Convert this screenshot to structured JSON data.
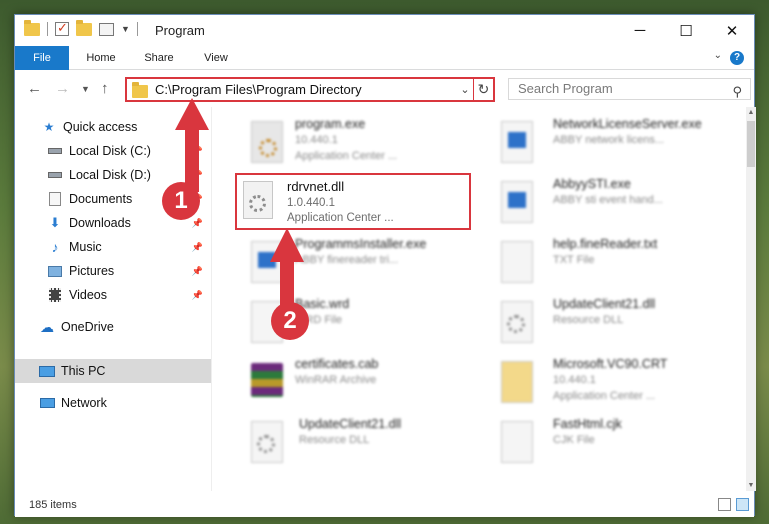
{
  "window": {
    "title": "Program",
    "controls": {
      "minimize": "─",
      "maximize": "☐",
      "close": "✕"
    }
  },
  "ribbon": {
    "tabs": [
      "File",
      "Home",
      "Share",
      "View"
    ],
    "help": "?"
  },
  "address_bar": {
    "path": "C:\\Program Files\\Program Directory",
    "search_placeholder": "Search Program"
  },
  "nav_pane": {
    "items": [
      {
        "label": "Quick access",
        "icon": "star-icon",
        "pinned": false
      },
      {
        "label": "Local Disk (C:)",
        "icon": "drive-icon",
        "pinned": true
      },
      {
        "label": "Local Disk (D:)",
        "icon": "drive-icon",
        "pinned": true
      },
      {
        "label": "Documents",
        "icon": "documents-icon",
        "pinned": true
      },
      {
        "label": "Downloads",
        "icon": "download-icon",
        "pinned": true
      },
      {
        "label": "Music",
        "icon": "music-icon",
        "pinned": true
      },
      {
        "label": "Pictures",
        "icon": "pictures-icon",
        "pinned": true
      },
      {
        "label": "Videos",
        "icon": "videos-icon",
        "pinned": true
      },
      {
        "label": "OneDrive",
        "icon": "cloud-icon",
        "pinned": false
      },
      {
        "label": "This PC",
        "icon": "computer-icon",
        "pinned": false,
        "selected": true
      },
      {
        "label": "Network",
        "icon": "network-icon",
        "pinned": false
      }
    ]
  },
  "files": [
    {
      "name": "program.exe",
      "line2": "10.440.1",
      "line3": "Application Center ...",
      "icon": "exe-icon"
    },
    {
      "name": "NetworkLicenseServer.exe",
      "line2": "ABBY network licens...",
      "line3": "",
      "icon": "window-app-icon"
    },
    {
      "name": "rdrvnet.dll",
      "line2": "1.0.440.1",
      "line3": "Application Center ...",
      "icon": "dll-gear-icon",
      "highlighted": true
    },
    {
      "name": "AbbyySTI.exe",
      "line2": "ABBY sti event hand...",
      "line3": "",
      "icon": "window-app-icon"
    },
    {
      "name": "ProgrammsInstaller.exe",
      "line2": "ABBY finereader tri...",
      "line3": "",
      "icon": "window-app-icon"
    },
    {
      "name": "help.fineReader.txt",
      "line2": "TXT File",
      "line3": "",
      "icon": "text-file-icon"
    },
    {
      "name": "Basic.wrd",
      "line2": "WRD File",
      "line3": "",
      "icon": "file-icon"
    },
    {
      "name": "UpdateClient21.dll",
      "line2": "Resource DLL",
      "line3": "",
      "icon": "dll-gear-icon"
    },
    {
      "name": "certificates.cab",
      "line2": "WinRAR Archive",
      "line3": "",
      "icon": "winrar-icon"
    },
    {
      "name": "Microsoft.VC90.CRT",
      "line2": "10.440.1",
      "line3": "Application Center ...",
      "icon": "folder-icon"
    },
    {
      "name": "UpdateClient21.dll",
      "line2": "Resource DLL",
      "line3": "",
      "icon": "dll-gear-icon"
    },
    {
      "name": "FastHtml.cjk",
      "line2": "CJK File",
      "line3": "",
      "icon": "file-icon"
    }
  ],
  "status": {
    "item_count": "185 items"
  },
  "annotations": {
    "marker1": "1",
    "marker2": "2",
    "color": "#d9363e"
  }
}
